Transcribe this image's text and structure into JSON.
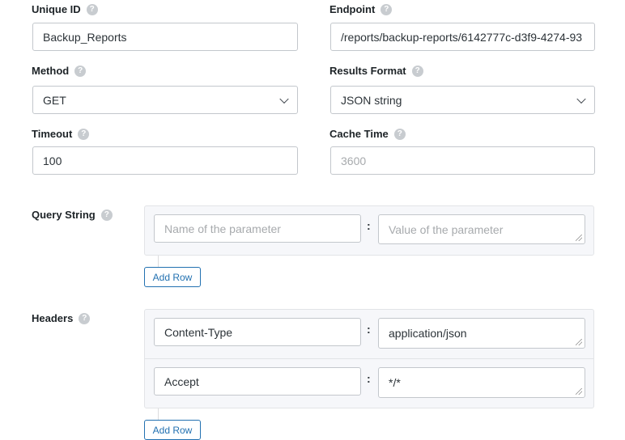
{
  "fields": {
    "unique_id": {
      "label": "Unique ID",
      "value": "Backup_Reports"
    },
    "endpoint": {
      "label": "Endpoint",
      "value": "/reports/backup-reports/6142777c-d3f9-4274-93"
    },
    "method": {
      "label": "Method",
      "value": "GET"
    },
    "results_format": {
      "label": "Results Format",
      "value": "JSON string"
    },
    "timeout": {
      "label": "Timeout",
      "value": "100"
    },
    "cache_time": {
      "label": "Cache Time",
      "placeholder": "3600"
    }
  },
  "help_glyph": "?",
  "query_string": {
    "label": "Query String",
    "rows": [
      {
        "name_placeholder": "Name of the parameter",
        "value_placeholder": "Value of the parameter"
      }
    ],
    "add_row_label": "Add Row"
  },
  "headers": {
    "label": "Headers",
    "rows": [
      {
        "name": "Content-Type",
        "value": "application/json"
      },
      {
        "name": "Accept",
        "value": "*/*"
      }
    ],
    "add_row_label": "Add Row"
  },
  "separator": ":"
}
